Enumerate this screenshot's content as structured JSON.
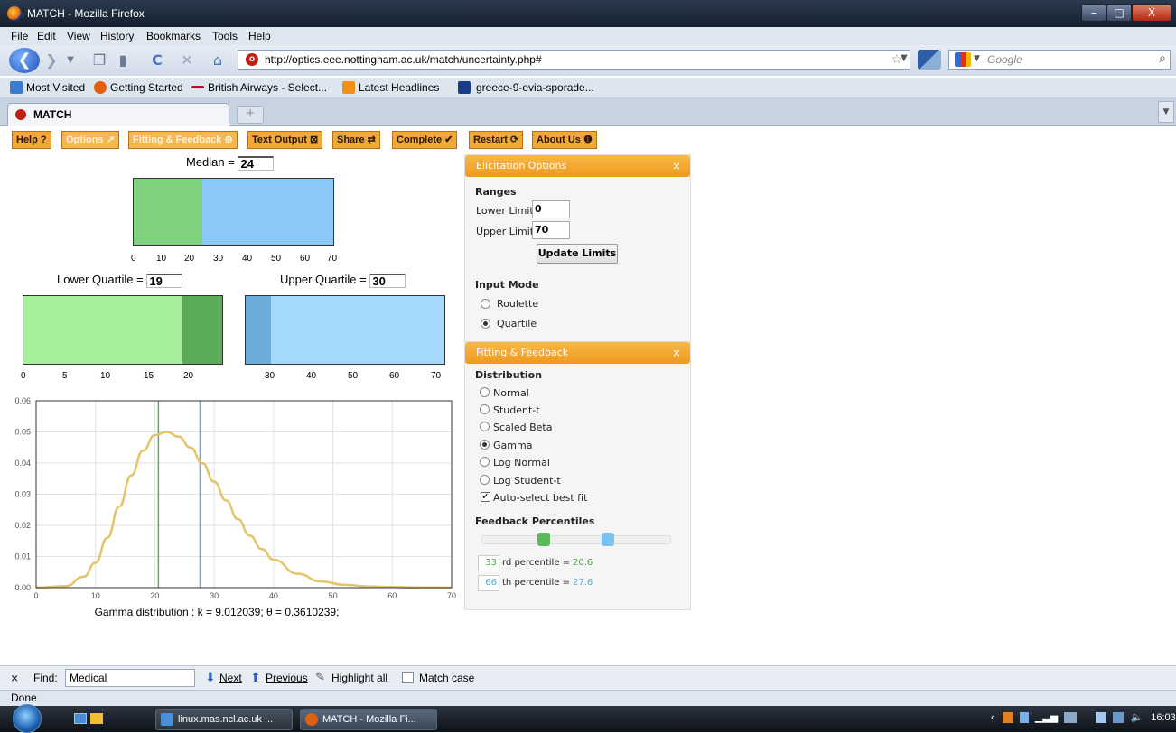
{
  "window": {
    "title": "MATCH - Mozilla Firefox",
    "min": "–",
    "max": "□",
    "close": "X"
  },
  "menu": [
    "File",
    "Edit",
    "View",
    "History",
    "Bookmarks",
    "Tools",
    "Help"
  ],
  "nav": {
    "url": "http://optics.eee.nottingham.ac.uk/match/uncertainty.php#",
    "search_placeholder": "Google"
  },
  "bookmarks": [
    "Most Visited",
    "Getting Started",
    "British Airways - Select...",
    "Latest Headlines",
    "greece-9-evia-sporade..."
  ],
  "tabs": {
    "active": "MATCH",
    "new_tab": "+"
  },
  "toolbar": [
    {
      "label": "Help ?",
      "dim": false
    },
    {
      "label": "Options ↗",
      "dim": true
    },
    {
      "label": "Fitting & Feedback ⊕",
      "dim": true
    },
    {
      "label": "Text Output ⊠",
      "dim": false
    },
    {
      "label": "Share ⇄",
      "dim": false
    },
    {
      "label": "Complete ✔",
      "dim": false
    },
    {
      "label": "Restart ⟳",
      "dim": false
    },
    {
      "label": "About Us ❶",
      "dim": false
    }
  ],
  "median": {
    "label": "Median =",
    "value": "24",
    "ticks": [
      "0",
      "10",
      "20",
      "30",
      "40",
      "50",
      "60",
      "70"
    ]
  },
  "lower_quartile": {
    "label": "Lower Quartile =",
    "value": "19",
    "ticks": [
      "0",
      "5",
      "10",
      "15",
      "20"
    ]
  },
  "upper_quartile": {
    "label": "Upper Quartile =",
    "value": "30",
    "ticks": [
      "30",
      "40",
      "50",
      "60",
      "70"
    ]
  },
  "colors": {
    "green": "#7fd07f",
    "blue": "#8ec8f8",
    "light_green": "#a6ee9c",
    "dark_green": "#5aaa5a",
    "light_blue": "#a4d9fb",
    "mid_blue": "#6aacdc",
    "curve": "#e4c46a",
    "orange": "#f0a838"
  },
  "chart_data": {
    "type": "line",
    "xlim": [
      0,
      70
    ],
    "ylim": [
      0,
      0.06
    ],
    "x_ticks": [
      "0",
      "10",
      "20",
      "30",
      "40",
      "50",
      "60",
      "70"
    ],
    "y_ticks": [
      "0.00",
      "0.01",
      "0.02",
      "0.03",
      "0.04",
      "0.05",
      "0.06"
    ],
    "distribution": {
      "k": 9.012039,
      "theta": 0.3610239
    },
    "series": [
      {
        "x": [
          0,
          5,
          8,
          10,
          12,
          14,
          16,
          18,
          20,
          22,
          24,
          26,
          28,
          30,
          32,
          34,
          36,
          38,
          40,
          44,
          48,
          52,
          56,
          60,
          65,
          70
        ],
        "y": [
          0.0,
          0.0005,
          0.0035,
          0.008,
          0.016,
          0.026,
          0.036,
          0.044,
          0.049,
          0.05,
          0.0485,
          0.045,
          0.04,
          0.034,
          0.028,
          0.022,
          0.0167,
          0.0124,
          0.009,
          0.0045,
          0.002,
          0.0009,
          0.0004,
          0.0002,
          5e-05,
          0.0
        ]
      }
    ],
    "vlines": [
      {
        "x": 20.6,
        "color": "#5aaa5a"
      },
      {
        "x": 27.6,
        "color": "#6aacdc"
      }
    ],
    "caption": "Gamma distribution : k = 9.012039; θ = 0.3610239;"
  },
  "elicitation": {
    "title": "Elicitation Options",
    "close": "×",
    "ranges_label": "Ranges",
    "lower_label": "Lower Limit",
    "lower_value": "0",
    "upper_label": "Upper Limit",
    "upper_value": "70",
    "update_button": "Update Limits",
    "input_mode_label": "Input Mode",
    "modes": [
      {
        "label": "Roulette",
        "selected": false
      },
      {
        "label": "Quartile",
        "selected": true
      }
    ]
  },
  "fitting": {
    "title": "Fitting & Feedback",
    "close": "×",
    "distribution_label": "Distribution",
    "distributions": [
      {
        "label": "Normal",
        "selected": false
      },
      {
        "label": "Student-t",
        "selected": false
      },
      {
        "label": "Scaled Beta",
        "selected": false
      },
      {
        "label": "Gamma",
        "selected": true
      },
      {
        "label": "Log Normal",
        "selected": false
      },
      {
        "label": "Log Student-t",
        "selected": false
      }
    ],
    "auto_select": {
      "label": "Auto-select best fit",
      "checked": true
    },
    "feedback_label": "Feedback Percentiles",
    "percentile_low": {
      "value": "33",
      "suffix": "rd percentile =",
      "result": "20.6"
    },
    "percentile_high": {
      "value": "66",
      "suffix": "th percentile =",
      "result": "27.6"
    }
  },
  "findbar": {
    "close": "×",
    "label": "Find:",
    "value": "Medical",
    "next": "Next",
    "previous": "Previous",
    "highlight": "Highlight all",
    "match_case": "Match case"
  },
  "status": "Done",
  "taskbar": {
    "task1": "linux.mas.ncl.ac.uk ...",
    "task2": "MATCH - Mozilla Fi...",
    "clock": "16:03"
  }
}
